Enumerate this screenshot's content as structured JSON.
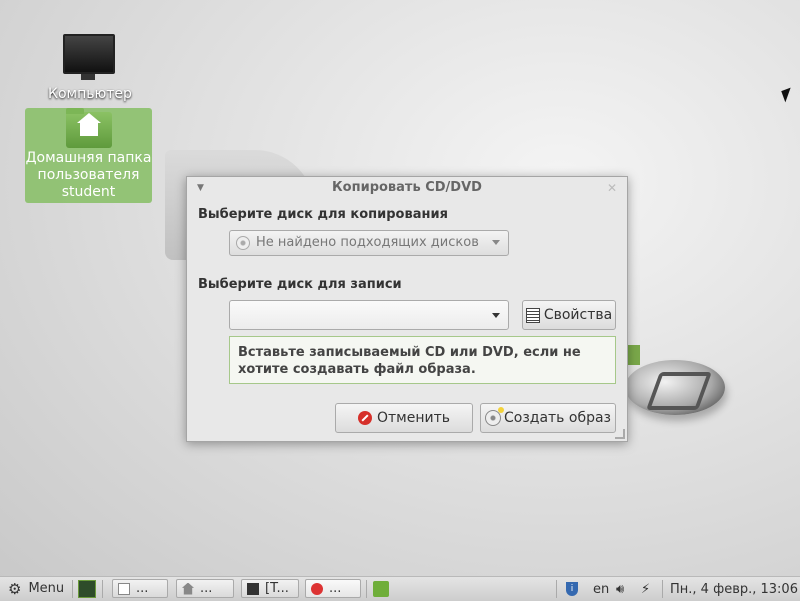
{
  "desktop": {
    "icons": [
      {
        "label": "Компьютер"
      },
      {
        "label_lines": [
          "Домашняя папка",
          "пользователя",
          "student"
        ]
      }
    ]
  },
  "dialog": {
    "title": "Копировать CD/DVD",
    "source_label": "Выберите диск для копирования",
    "source_value": "Не найдено подходящих дисков",
    "dest_label": "Выберите диск для записи",
    "dest_value": "",
    "properties_button": "Свойства",
    "info_text": "Вставьте записываемый CD или DVD, если не хотите создавать файл образа.",
    "cancel_button": "Отменить",
    "create_button": "Создать образ"
  },
  "taskbar": {
    "menu_label": "Menu",
    "windows": [
      {
        "icon": "document-icon",
        "label": "..."
      },
      {
        "icon": "home-folder-icon",
        "label": "..."
      },
      {
        "icon": "terminal-icon",
        "label": "[T..."
      },
      {
        "icon": "disc-burner-icon",
        "label": "..."
      }
    ],
    "keyboard_layout": "en",
    "clock": "Пн.,  4 февр., 13:06"
  },
  "colors": {
    "accent_green": "#86be64",
    "info_border": "#a6c88a",
    "cancel_red": "#d6302a"
  }
}
